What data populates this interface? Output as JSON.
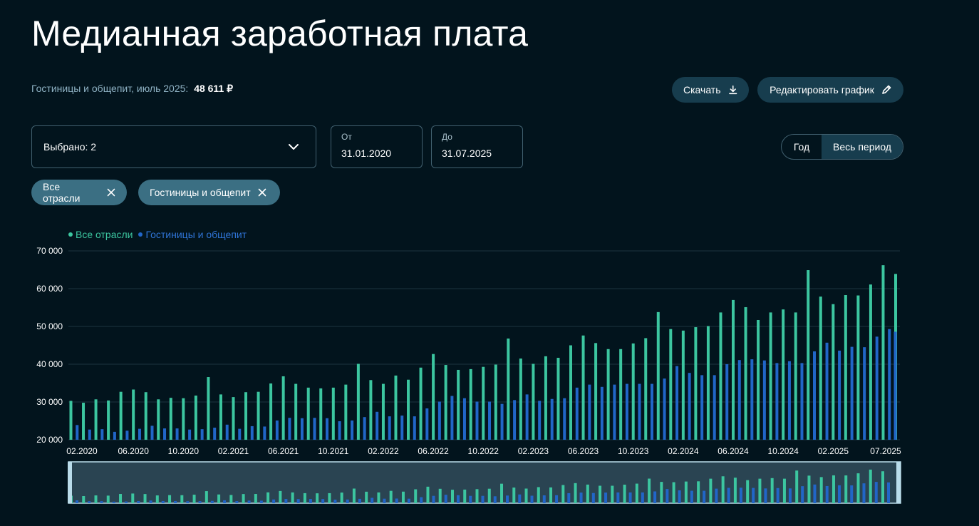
{
  "page": {
    "title": "Медианная заработная плата",
    "subtitle_label": "Гостиницы и общепит, июль 2025:",
    "subtitle_value": "48 611 ₽"
  },
  "toolbar": {
    "download_label": "Скачать",
    "edit_label": "Редактировать график"
  },
  "filters": {
    "selected_label": "Выбрано: 2",
    "from_label": "От",
    "from_value": "31.01.2020",
    "to_label": "До",
    "to_value": "31.07.2025",
    "period_year": "Год",
    "period_all": "Весь период",
    "chips": [
      "Все отрасли",
      "Гостиницы и общепит"
    ]
  },
  "colors": {
    "all": "#3cc6a0",
    "hotels": "#2166c8",
    "grid": "#1c3340",
    "brush": "#b9dcea"
  },
  "chart_data": {
    "type": "bar",
    "xlabel": "",
    "ylabel": "",
    "ylim": [
      20000,
      70000
    ],
    "yticks": [
      20000,
      30000,
      40000,
      50000,
      60000,
      70000
    ],
    "ytick_labels": [
      "20 000",
      "30 000",
      "40 000",
      "50 000",
      "60 000",
      "70 000"
    ],
    "xtick_labels": [
      "02.2020",
      "06.2020",
      "10.2020",
      "02.2021",
      "06.2021",
      "10.2021",
      "02.2022",
      "06.2022",
      "10.2022",
      "02.2023",
      "06.2023",
      "10.2023",
      "02.2024",
      "06.2024",
      "10.2024",
      "02.2025",
      "07.2025"
    ],
    "categories": [
      "01.2020",
      "02.2020",
      "03.2020",
      "04.2020",
      "05.2020",
      "06.2020",
      "07.2020",
      "08.2020",
      "09.2020",
      "10.2020",
      "11.2020",
      "12.2020",
      "01.2021",
      "02.2021",
      "03.2021",
      "04.2021",
      "05.2021",
      "06.2021",
      "07.2021",
      "08.2021",
      "09.2021",
      "10.2021",
      "11.2021",
      "12.2021",
      "01.2022",
      "02.2022",
      "03.2022",
      "04.2022",
      "05.2022",
      "06.2022",
      "07.2022",
      "08.2022",
      "09.2022",
      "10.2022",
      "11.2022",
      "12.2022",
      "01.2023",
      "02.2023",
      "03.2023",
      "04.2023",
      "05.2023",
      "06.2023",
      "07.2023",
      "08.2023",
      "09.2023",
      "10.2023",
      "11.2023",
      "12.2023",
      "01.2024",
      "02.2024",
      "03.2024",
      "04.2024",
      "05.2024",
      "06.2024",
      "07.2024",
      "08.2024",
      "09.2024",
      "10.2024",
      "11.2024",
      "12.2024",
      "01.2025",
      "02.2025",
      "03.2025",
      "04.2025",
      "05.2025",
      "06.2025",
      "07.2025"
    ],
    "series": [
      {
        "name": "Все отрасли",
        "values": [
          30300,
          29800,
          30700,
          30400,
          32700,
          33300,
          32600,
          30700,
          31100,
          31000,
          31700,
          36600,
          32000,
          31300,
          32600,
          32700,
          34900,
          36800,
          34800,
          33800,
          33600,
          33800,
          34600,
          40100,
          35800,
          34800,
          37000,
          35900,
          39100,
          42700,
          39800,
          38500,
          38700,
          39300,
          39900,
          46800,
          41500,
          40100,
          42100,
          41700,
          45000,
          47600,
          45600,
          44000,
          44000,
          45500,
          46900,
          53800,
          49300,
          48900,
          49800,
          50100,
          53700,
          57000,
          55100,
          51700,
          53700,
          54500,
          53700,
          64900,
          57900,
          55900,
          58300,
          58200,
          61100,
          66200,
          63900
        ]
      },
      {
        "name": "Гостиницы и общепит",
        "values": [
          23900,
          22700,
          22800,
          22100,
          22400,
          22900,
          23700,
          23000,
          23000,
          22700,
          22800,
          23200,
          24000,
          22900,
          23600,
          23500,
          25100,
          25800,
          25700,
          25800,
          25700,
          24900,
          25100,
          26000,
          27400,
          26200,
          26400,
          26200,
          28300,
          30100,
          31600,
          31000,
          30100,
          30100,
          29500,
          30500,
          32000,
          30300,
          30800,
          31000,
          33800,
          34600,
          34000,
          34600,
          34800,
          34800,
          34800,
          36200,
          39500,
          37700,
          37100,
          37100,
          40000,
          41100,
          41300,
          41000,
          40300,
          40800,
          40300,
          43400,
          45700,
          43600,
          44600,
          44500,
          47300,
          49300,
          48600
        ]
      }
    ]
  }
}
